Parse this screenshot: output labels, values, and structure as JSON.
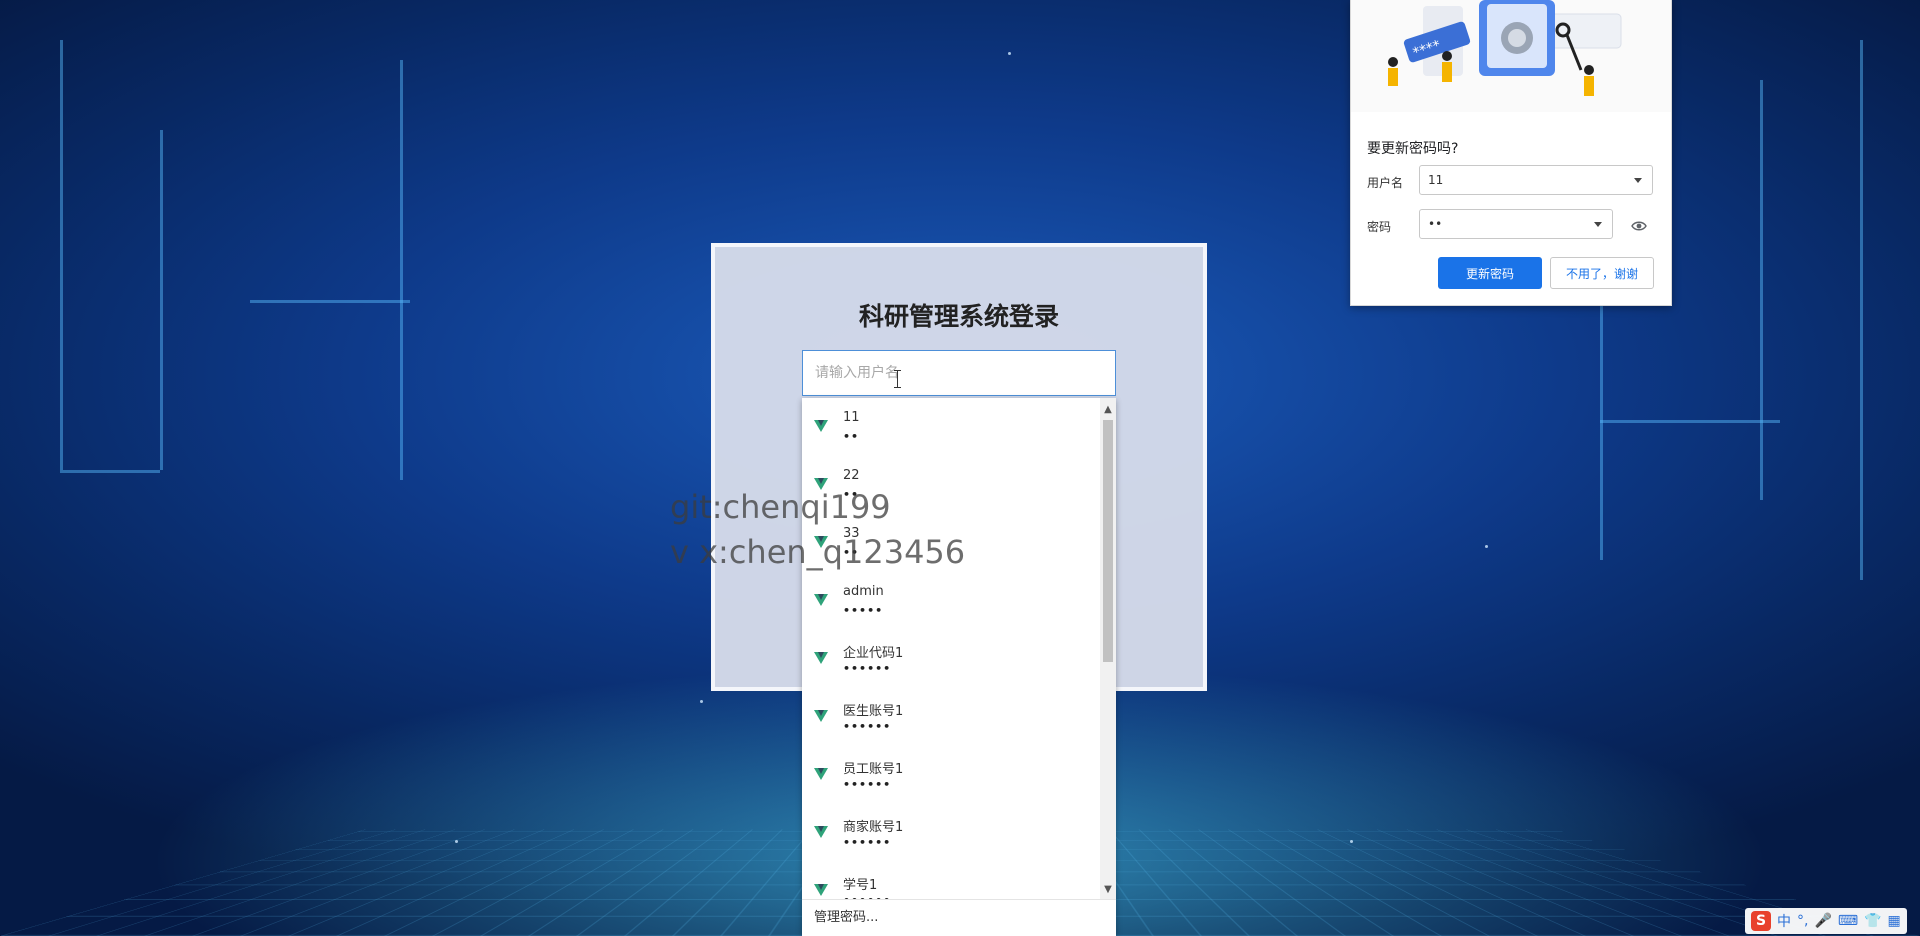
{
  "login": {
    "title": "科研管理系统登录",
    "username_placeholder": "请输入用户名",
    "username_value": ""
  },
  "autocomplete": {
    "items": [
      {
        "name": "11",
        "password_mask": "••"
      },
      {
        "name": "22",
        "password_mask": "••"
      },
      {
        "name": "33",
        "password_mask": "••"
      },
      {
        "name": "admin",
        "password_mask": "•••••"
      },
      {
        "name": "企业代码1",
        "password_mask": "••••••"
      },
      {
        "name": "医生账号1",
        "password_mask": "••••••"
      },
      {
        "name": "员工账号1",
        "password_mask": "••••••"
      },
      {
        "name": "商家账号1",
        "password_mask": "••••••"
      },
      {
        "name": "学号1",
        "password_mask": "••••••"
      }
    ],
    "footer_label": "管理密码..."
  },
  "watermark": {
    "line1": "git:chenqi199",
    "line2": "v x:chen_q123456"
  },
  "password_prompt": {
    "title": "要更新密码吗?",
    "username_label": "用户名",
    "username_value": "11",
    "password_label": "密码",
    "password_value": "••",
    "update_button": "更新密码",
    "dismiss_button": "不用了，谢谢",
    "illustration_text": "****"
  },
  "ime": {
    "logo": "S",
    "lang": "中",
    "punct": "°,"
  },
  "colors": {
    "accent": "#1a73e8",
    "vue_green": "#2fa37a",
    "panel": "#d6dcea"
  }
}
